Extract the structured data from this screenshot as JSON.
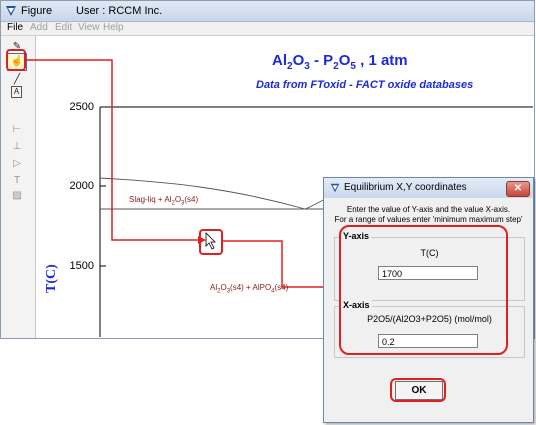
{
  "window": {
    "title": "Figure",
    "user_label": "User : RCCM Inc."
  },
  "menu": [
    {
      "label": "File",
      "enabled": true
    },
    {
      "label": "Add",
      "enabled": false
    },
    {
      "label": "Edit",
      "enabled": false
    },
    {
      "label": "View",
      "enabled": false
    },
    {
      "label": "Help",
      "enabled": false
    }
  ],
  "toolbar": {
    "tools": [
      {
        "icon": "pen-icon",
        "glyph": "✎"
      },
      {
        "icon": "pointer-select-icon",
        "glyph": "☝",
        "selected": true
      },
      {
        "icon": "line-icon",
        "glyph": "╱"
      },
      {
        "icon": "text-box-icon",
        "glyph": "A"
      },
      {
        "icon": "tick-icon",
        "glyph": "⊢"
      },
      {
        "icon": "axis-icon",
        "glyph": "⊥"
      },
      {
        "icon": "arrow-tool-icon",
        "glyph": "▷"
      },
      {
        "icon": "text-icon",
        "glyph": "T"
      },
      {
        "icon": "paint-icon",
        "glyph": "▨"
      }
    ]
  },
  "plot": {
    "title_parts": [
      "Al",
      "2",
      "O",
      "3",
      " - P",
      "2",
      "O",
      "5",
      " , 1 atm"
    ],
    "subtitle": "Data from FToxid - FACT oxide databases",
    "ylabel": "T(C)",
    "yticks": [
      "2500",
      "2000",
      "1500"
    ],
    "regions": {
      "slag_prefix": "Slag-liq + Al",
      "slag_sub1": "2",
      "slag_mid": "O",
      "slag_sub2": "3",
      "slag_suffix": "(s4)",
      "lower_a": "Al",
      "lower_a_sub1": "2",
      "lower_b": "O",
      "lower_b_sub2": "3",
      "lower_c": "(s4) + AlPO",
      "lower_c_sub": "4",
      "lower_d": "(s4)"
    },
    "colors": {
      "title": "#1d2bd6",
      "region_text": "#8b1a1a",
      "highlight": "#e02020"
    }
  },
  "dialog": {
    "title": "Equilibrium X,Y coordinates",
    "close_label": "✕",
    "instructions": [
      "Enter the value of Y-axis and the value X-axis.",
      "For a range of values enter 'minimum maximum step'"
    ],
    "y_axis": {
      "group_label": "Y-axis",
      "name": "T(C)",
      "value": "1700"
    },
    "x_axis": {
      "group_label": "X-axis",
      "name": "P2O5/(Al2O3+P2O5) (mol/mol)",
      "value": "0.2"
    },
    "ok_label": "OK"
  }
}
